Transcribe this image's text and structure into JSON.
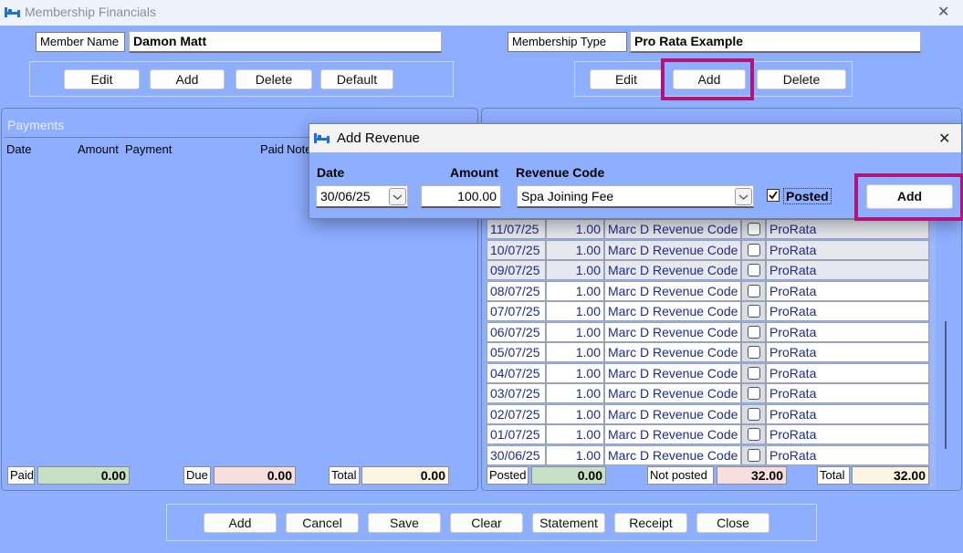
{
  "window": {
    "title": "Membership Financials"
  },
  "member": {
    "label": "Member Name",
    "value": "Damon Matt"
  },
  "membership_type": {
    "label": "Membership Type",
    "value": "Pro Rata Example"
  },
  "member_buttons": [
    "Edit",
    "Add",
    "Delete",
    "Default"
  ],
  "type_buttons": [
    "Edit",
    "Add",
    "Delete"
  ],
  "payments": {
    "title": "Payments",
    "headers": [
      "Date",
      "Amount",
      "Payment",
      "Paid",
      "Note"
    ],
    "paid_label": "Paid",
    "paid_value": "0.00",
    "due_label": "Due",
    "due_value": "0.00",
    "total_label": "Total",
    "total_value": "0.00"
  },
  "revenue": {
    "rows": [
      {
        "date": "11/07/25",
        "amount": "1.00",
        "code": "Marc D Revenue Code",
        "ref": "ProRata"
      },
      {
        "date": "10/07/25",
        "amount": "1.00",
        "code": "Marc D Revenue Code",
        "ref": "ProRata"
      },
      {
        "date": "09/07/25",
        "amount": "1.00",
        "code": "Marc D Revenue Code",
        "ref": "ProRata"
      },
      {
        "date": "08/07/25",
        "amount": "1.00",
        "code": "Marc D Revenue Code",
        "ref": "ProRata"
      },
      {
        "date": "07/07/25",
        "amount": "1.00",
        "code": "Marc D Revenue Code",
        "ref": "ProRata"
      },
      {
        "date": "06/07/25",
        "amount": "1.00",
        "code": "Marc D Revenue Code",
        "ref": "ProRata"
      },
      {
        "date": "05/07/25",
        "amount": "1.00",
        "code": "Marc D Revenue Code",
        "ref": "ProRata"
      },
      {
        "date": "04/07/25",
        "amount": "1.00",
        "code": "Marc D Revenue Code",
        "ref": "ProRata"
      },
      {
        "date": "03/07/25",
        "amount": "1.00",
        "code": "Marc D Revenue Code",
        "ref": "ProRata"
      },
      {
        "date": "02/07/25",
        "amount": "1.00",
        "code": "Marc D Revenue Code",
        "ref": "ProRata"
      },
      {
        "date": "01/07/25",
        "amount": "1.00",
        "code": "Marc D Revenue Code",
        "ref": "ProRata"
      },
      {
        "date": "30/06/25",
        "amount": "1.00",
        "code": "Marc D Revenue Code",
        "ref": "ProRata"
      }
    ],
    "posted_label": "Posted",
    "posted_value": "0.00",
    "notposted_label": "Not posted",
    "notposted_value": "32.00",
    "total_label": "Total",
    "total_value": "32.00"
  },
  "dialog": {
    "title": "Add Revenue",
    "date_label": "Date",
    "date_value": "30/06/25",
    "amount_label": "Amount",
    "amount_value": "100.00",
    "code_label": "Revenue Code",
    "code_value": "Spa Joining Fee",
    "posted_label": "Posted",
    "add_label": "Add"
  },
  "bottom_buttons": [
    "Add",
    "Cancel",
    "Save",
    "Clear",
    "Statement",
    "Receipt",
    "Close"
  ],
  "colors": {
    "background": "#8eaeff",
    "highlight": "#b0157a"
  }
}
